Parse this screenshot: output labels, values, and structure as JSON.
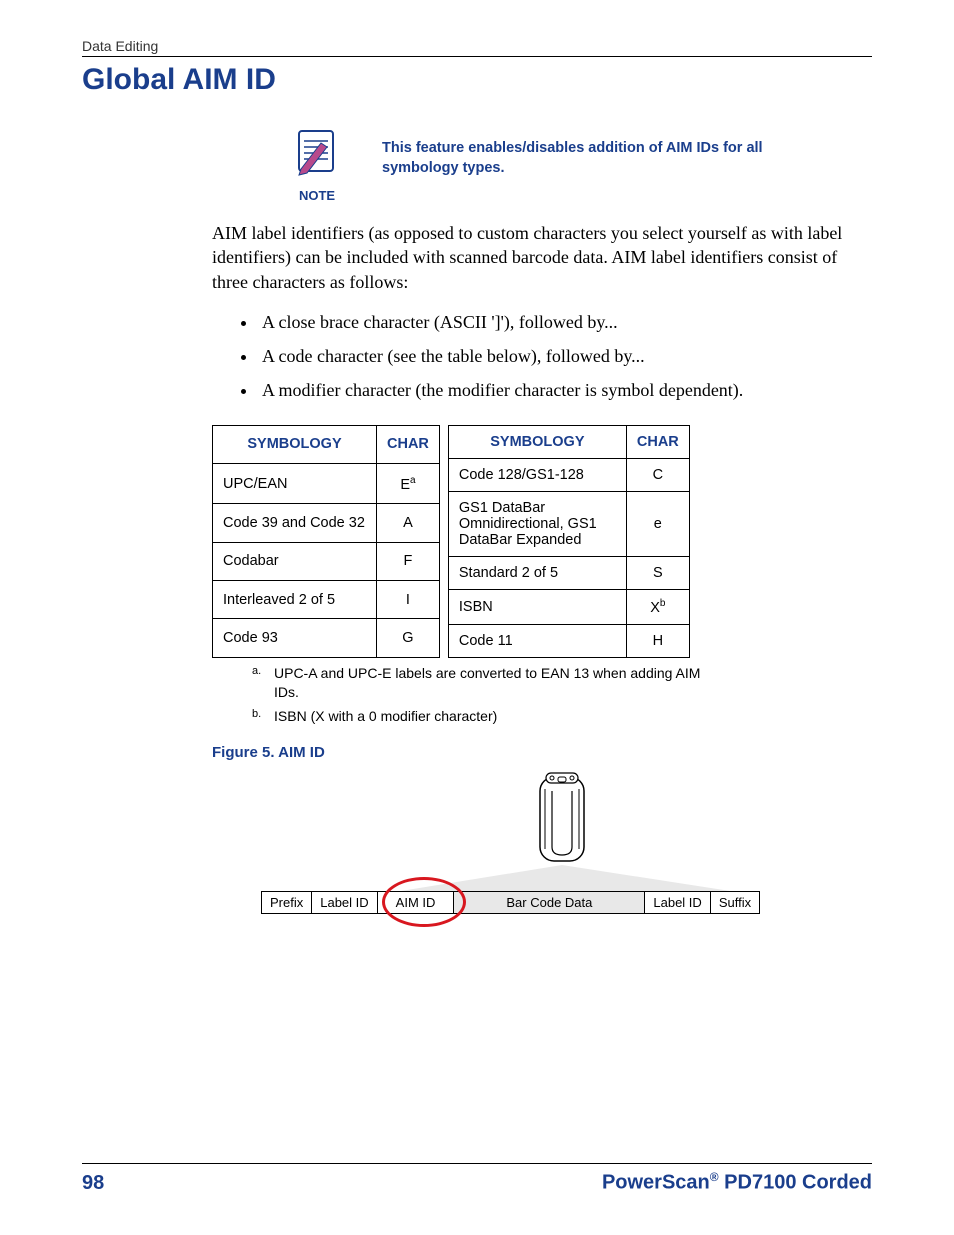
{
  "header": {
    "section": "Data Editing"
  },
  "title": "Global AIM ID",
  "note": {
    "label": "NOTE",
    "text": "This feature enables/disables addition of AIM IDs for all symbology types."
  },
  "intro": "AIM label identifiers (as opposed to custom characters you select yourself as with label identifiers) can be included with scanned barcode data. AIM label identifiers consist of three characters as follows:",
  "bullets": [
    "A close brace character (ASCII ']'), followed by...",
    "A code character (see the table below), followed by...",
    "A modifier character (the modifier character is symbol dependent)."
  ],
  "table_headers": {
    "symbology": "SYMBOLOGY",
    "char": "CHAR"
  },
  "left_rows": [
    {
      "sym": "UPC/EAN",
      "char": "E",
      "sup": "a"
    },
    {
      "sym": "Code 39 and Code 32",
      "char": "A"
    },
    {
      "sym": "Codabar",
      "char": "F"
    },
    {
      "sym": "Interleaved 2 of 5",
      "char": "I"
    },
    {
      "sym": "Code 93",
      "char": "G"
    }
  ],
  "right_rows": [
    {
      "sym": "Code 128/GS1-128",
      "char": "C"
    },
    {
      "sym": "GS1 DataBar Omnidirectional, GS1 DataBar Expanded",
      "char": "e"
    },
    {
      "sym": "Standard 2 of 5",
      "char": "S"
    },
    {
      "sym": "ISBN",
      "char": "X",
      "sup": "b"
    },
    {
      "sym": "Code 11",
      "char": "H"
    }
  ],
  "footnotes": [
    {
      "mark": "a.",
      "text": "UPC-A and UPC-E labels are converted to EAN 13 when adding AIM IDs."
    },
    {
      "mark": "b.",
      "text": "ISBN (X with a 0 modifier character)"
    }
  ],
  "figure": {
    "caption": "Figure 5. AIM ID",
    "segments": {
      "prefix": "Prefix",
      "label_id_1": "Label ID",
      "aim_id": "AIM ID",
      "bar_code_data": "Bar Code Data",
      "label_id_2": "Label ID",
      "suffix": "Suffix"
    }
  },
  "footer": {
    "page": "98",
    "product_pre": "PowerScan",
    "reg": "®",
    "product_post": " PD7100 Corded"
  }
}
